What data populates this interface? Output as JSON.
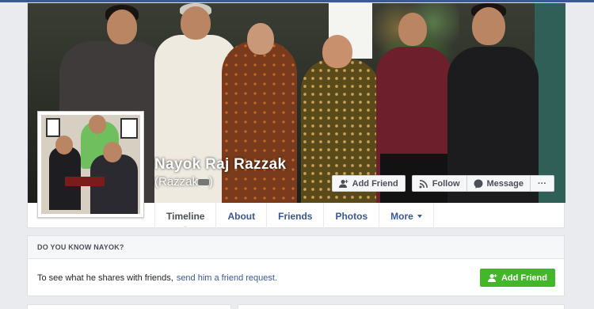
{
  "profile": {
    "name": "Nayok Raj Razzak",
    "alternate_name": "(Razzak",
    "alternate_name_close": ")"
  },
  "cover_actions": {
    "add_friend": "Add Friend",
    "follow": "Follow",
    "message": "Message",
    "more": "···"
  },
  "tabs": [
    {
      "label": "Timeline"
    },
    {
      "label": "About"
    },
    {
      "label": "Friends"
    },
    {
      "label": "Photos"
    },
    {
      "label": "More"
    }
  ],
  "know_card": {
    "header": "DO YOU KNOW NAYOK?",
    "body_text": "To see what he shares with friends,",
    "link_text": "send him a friend request.",
    "button": "Add Friend"
  },
  "colors": {
    "brand": "#3b5998",
    "link": "#385898",
    "green": "#42b72a"
  },
  "icons": [
    "add-friend-icon",
    "rss-icon",
    "messenger-icon",
    "chevron-down-icon"
  ]
}
